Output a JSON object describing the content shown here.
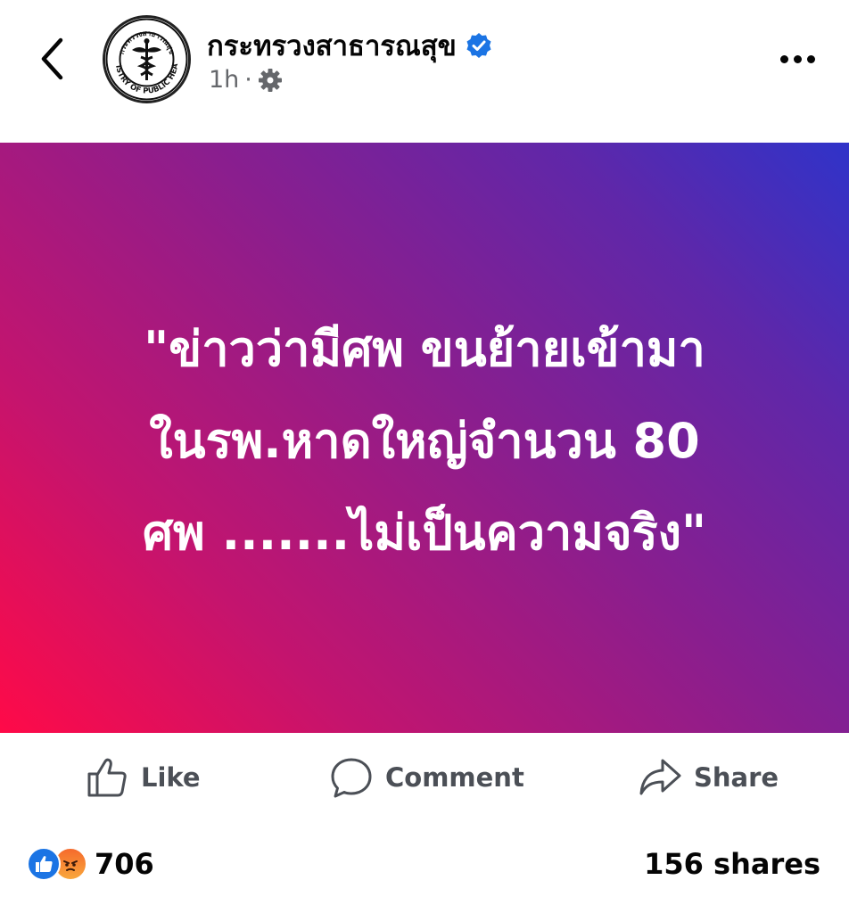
{
  "header": {
    "page_name": "กระทรวงสาธารณสุข",
    "time": "1h",
    "separator": "·",
    "avatar_caption": "MINISTRY OF PUBLIC HEALTH",
    "avatar_top_text": "กระทรวงสาธารณสุข",
    "icons": {
      "back": "chevron-left-icon",
      "verified": "verified-badge-icon",
      "audience": "gear-icon",
      "more": "more-dots-icon"
    }
  },
  "post": {
    "lines": [
      "\"ข่าวว่ามีศพ ขนย้ายเข้ามา",
      "ในรพ.หาดใหญ่จำนวน 80",
      "ศพ .......ไม่เป็นความจริง\""
    ],
    "background_colors": [
      "#ff0a48",
      "#2f33c9"
    ]
  },
  "actions": {
    "like_label": "Like",
    "comment_label": "Comment",
    "share_label": "Share"
  },
  "stats": {
    "reaction_count": "706",
    "shares": "156 shares",
    "reactions": [
      "like",
      "angry"
    ]
  },
  "colors": {
    "verified": "#1b74e4",
    "text_secondary": "#65676b",
    "action_text": "#4b4f56"
  }
}
